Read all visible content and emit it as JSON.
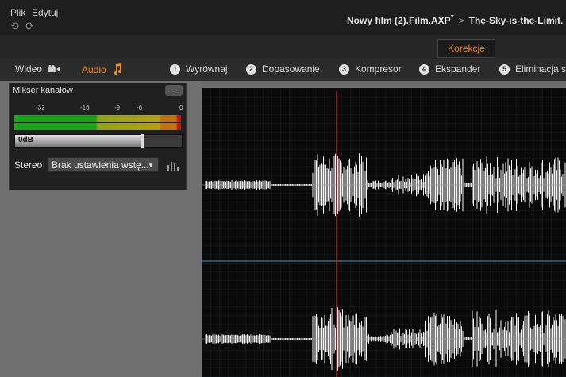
{
  "menu": {
    "file": "Plik",
    "edit": "Edytuj"
  },
  "breadcrumb": {
    "project": "Nowy film (2).Film.AXP",
    "modified_marker": "*",
    "separator": ">",
    "clip": "The-Sky-is-the-Limit."
  },
  "korekcje_label": "Korekcje",
  "tabs": {
    "video": "Wideo",
    "audio": "Audio",
    "steps": [
      {
        "num": "1",
        "label": "Wyrównaj"
      },
      {
        "num": "2",
        "label": "Dopasowanie"
      },
      {
        "num": "3",
        "label": "Kompresor"
      },
      {
        "num": "4",
        "label": "Ekspander"
      },
      {
        "num": "5",
        "label": "Eliminacja s"
      }
    ]
  },
  "mixer": {
    "title": "Mikser kanałów",
    "scale": [
      "-32",
      "-16",
      "-9",
      "-6",
      "0"
    ],
    "volume_label": "0dB",
    "volume_level": 0.76,
    "stereo_label": "Stereo",
    "preset": "Brak ustawienia wstę...",
    "icons": {
      "minimize": "minus-icon",
      "eq": "equalizer-icon",
      "video": "camera-icon",
      "audio": "music-note-icon"
    }
  },
  "colors": {
    "accent": "#f29218",
    "playhead": "#c81e1e",
    "center_line": "#2f6a8a"
  }
}
